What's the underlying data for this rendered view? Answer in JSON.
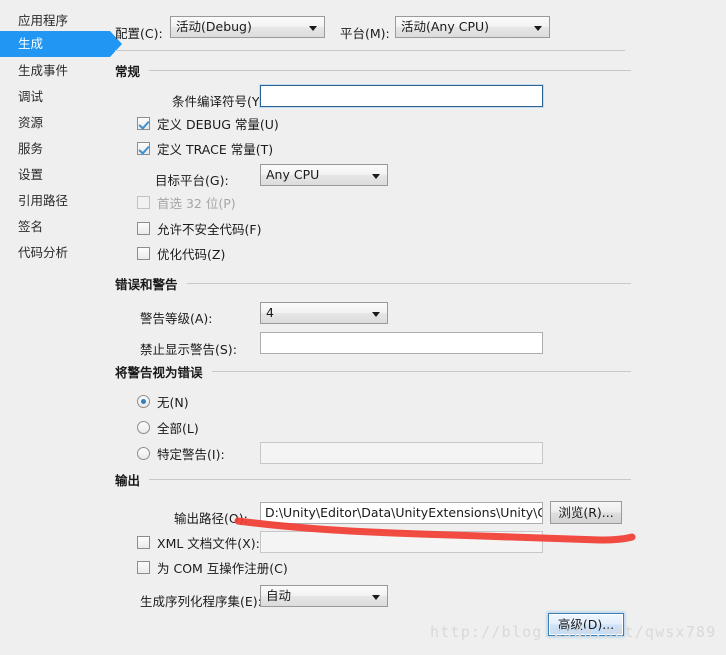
{
  "sidebar": {
    "items": [
      {
        "label": "应用程序",
        "selected": false
      },
      {
        "label": "生成",
        "selected": true
      },
      {
        "label": "生成事件",
        "selected": false
      },
      {
        "label": "调试",
        "selected": false
      },
      {
        "label": "资源",
        "selected": false
      },
      {
        "label": "服务",
        "selected": false
      },
      {
        "label": "设置",
        "selected": false
      },
      {
        "label": "引用路径",
        "selected": false
      },
      {
        "label": "签名",
        "selected": false
      },
      {
        "label": "代码分析",
        "selected": false
      }
    ]
  },
  "top": {
    "config_label": "配置(C):",
    "config_value": "活动(Debug)",
    "platform_label": "平台(M):",
    "platform_value": "活动(Any CPU)"
  },
  "general": {
    "group_title": "常规",
    "cond_symbols_label": "条件编译符号(Y):",
    "cond_symbols_value": "",
    "define_debug_label": "定义 DEBUG 常量(U)",
    "define_debug_checked": true,
    "define_trace_label": "定义 TRACE 常量(T)",
    "define_trace_checked": true,
    "target_platform_label": "目标平台(G):",
    "target_platform_value": "Any CPU",
    "prefer32_label": "首选 32 位(P)",
    "prefer32_checked": false,
    "unsafe_label": "允许不安全代码(F)",
    "unsafe_checked": false,
    "optimize_label": "优化代码(Z)",
    "optimize_checked": false
  },
  "errors": {
    "group_title": "错误和警告",
    "warn_level_label": "警告等级(A):",
    "warn_level_value": "4",
    "suppress_label": "禁止显示警告(S):",
    "suppress_value": ""
  },
  "warnings_as_errors": {
    "group_title": "将警告视为错误",
    "none_label": "无(N)",
    "all_label": "全部(L)",
    "specific_label": "特定警告(I):",
    "specific_value": "",
    "selected": "none"
  },
  "output": {
    "group_title": "输出",
    "path_label": "输出路径(O):",
    "path_value": "D:\\Unity\\Editor\\Data\\UnityExtensions\\Unity\\GUISyst",
    "browse_button": "浏览(R)...",
    "xml_doc_label": "XML 文档文件(X):",
    "xml_doc_checked": false,
    "xml_doc_value": "",
    "com_interop_label": "为 COM 互操作注册(C)",
    "com_interop_checked": false,
    "serialization_label": "生成序列化程序集(E):",
    "serialization_value": "自动",
    "advanced_button": "高级(D)..."
  },
  "annotation": {
    "watermark": "http://blog.csdn.net/qwsx789",
    "highlight_color": "#f03c32"
  },
  "colors": {
    "accent": "#2196f3",
    "background": "#efefef",
    "rule": "#c8c8c8"
  }
}
